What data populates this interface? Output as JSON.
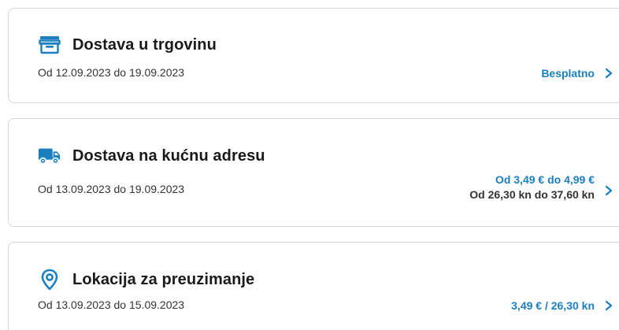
{
  "colors": {
    "accent": "#1a7fbf",
    "text": "#1a1a1a",
    "muted": "#333333",
    "border": "#d6d6d6"
  },
  "options": [
    {
      "icon": "store-icon",
      "title": "Dostava u trgovinu",
      "dates": "Od 12.09.2023 do 19.09.2023",
      "price_eur": "Besplatno",
      "price_kn": ""
    },
    {
      "icon": "truck-icon",
      "title": "Dostava na kućnu adresu",
      "dates": "Od 13.09.2023 do 19.09.2023",
      "price_eur": "Od 3,49 € do 4,99 €",
      "price_kn": "Od 26,30 kn do 37,60 kn"
    },
    {
      "icon": "location-pin-icon",
      "title": "Lokacija za preuzimanje",
      "dates": "Od 13.09.2023 do 15.09.2023",
      "price_eur": "3,49 € / 26,30 kn",
      "price_kn": ""
    }
  ]
}
